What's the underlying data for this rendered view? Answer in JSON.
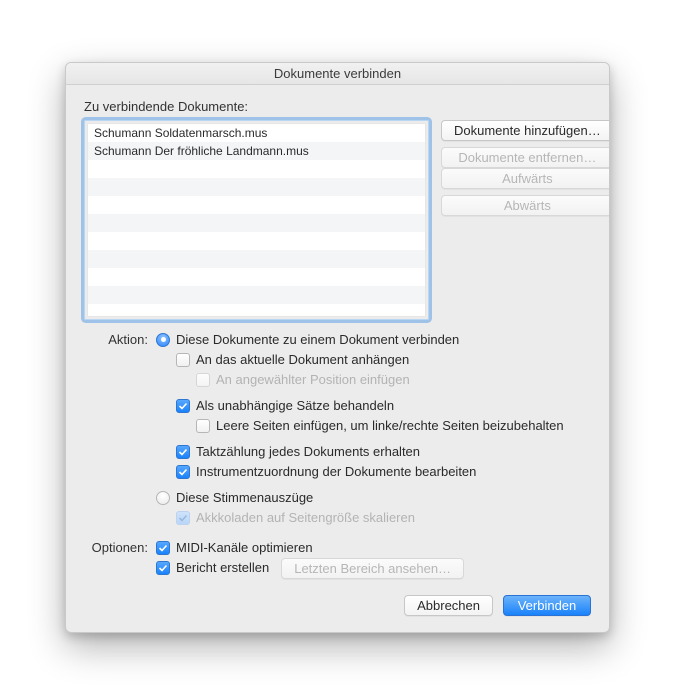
{
  "title": "Dokumente verbinden",
  "list_label": "Zu verbindende Dokumente:",
  "documents": [
    "Schumann Soldatenmarsch.mus",
    "Schumann Der fröhliche Landmann.mus"
  ],
  "buttons": {
    "add": "Dokumente hinzufügen…",
    "remove": "Dokumente entfernen…",
    "up": "Aufwärts",
    "down": "Abwärts",
    "cancel": "Abbrechen",
    "merge": "Verbinden",
    "last_report": "Letzten Bereich ansehen…"
  },
  "labels": {
    "action": "Aktion:",
    "options": "Optionen:"
  },
  "action": {
    "merge": "Diese Dokumente zu einem Dokument verbinden",
    "append": "An das aktuelle Dokument anhängen",
    "insert_at_sel": "An angewählter Position einfügen",
    "independent": "Als unabhängige Sätze behandeln",
    "blank_pages": "Leere Seiten einfügen, um linke/rechte Seiten beizubehalten",
    "keep_measure": "Taktzählung jedes Dokuments erhalten",
    "edit_instr": "Instrumentzuordnung der Dokumente bearbeiten",
    "parts": "Diese Stimmenauszüge",
    "scale_systems": "Akkkoladen auf Seitengröße skalieren"
  },
  "options": {
    "midi": "MIDI-Kanäle optimieren",
    "report": "Bericht erstellen"
  }
}
